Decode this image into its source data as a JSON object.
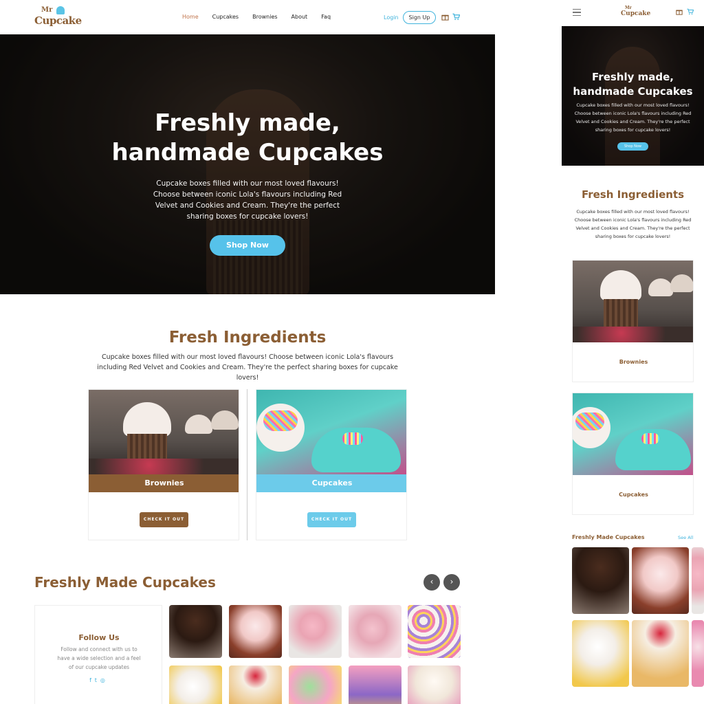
{
  "brand": {
    "mr": "Mr",
    "name": "Cupcake"
  },
  "nav": {
    "items": [
      {
        "label": "Home",
        "active": true
      },
      {
        "label": "Cupcakes"
      },
      {
        "label": "Brownies"
      },
      {
        "label": "About"
      },
      {
        "label": "Faq"
      }
    ],
    "login": "Login",
    "signup": "Sign Up"
  },
  "hero": {
    "title_line1": "Freshly made,",
    "title_line2": "handmade Cupcakes",
    "description": "Cupcake boxes filled with our most loved flavours! Choose between iconic Lola's flavours including Red Velvet and Cookies and Cream. They're the perfect sharing boxes for cupcake lovers!",
    "button": "Shop Now"
  },
  "fresh": {
    "title": "Fresh Ingredients",
    "description": "Cupcake boxes filled with our most loved flavours! Choose between iconic Lola's flavours including Red Velvet and Cookies and Cream. They're the perfect sharing boxes for cupcake lovers!",
    "cards": [
      {
        "label": "Brownies",
        "button": "CHECK IT OUT"
      },
      {
        "label": "Cupcakes",
        "button": "CHECK IT OUT"
      }
    ]
  },
  "freshly_made": {
    "title": "Freshly Made Cupcakes",
    "prev": "‹",
    "next": "›"
  },
  "follow": {
    "title": "Follow Us",
    "text": "Follow and connect with us to have a wide selection and a feel of our cupcake updates",
    "icons": [
      "facebook-icon",
      "twitter-icon",
      "instagram-icon"
    ]
  },
  "mobile": {
    "fresh_title": "Fresh Ingredients",
    "freshly_made_title": "Freshly Made Cupcakes",
    "see_all": "See All",
    "hero_button": "Shop Now"
  },
  "colors": {
    "brown": "#8b5e34",
    "sky": "#56c2ea",
    "accent_link": "#3fb3dc"
  }
}
